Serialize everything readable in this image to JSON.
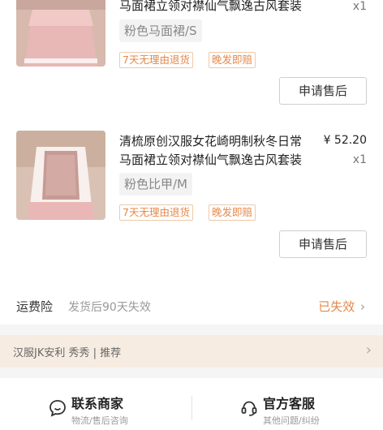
{
  "items": [
    {
      "title_line1": "",
      "title_line2": "马面裙立领对襟仙气飘逸古风套装",
      "price": "",
      "qty": "x1",
      "spec": "粉色马面裙/S",
      "tags": [
        "7天无理由退货",
        "晚发即赔"
      ],
      "button": "申请售后"
    },
    {
      "title_line1": "清梳原创汉服女花崎明制秋冬日常",
      "title_line2": "马面裙立领对襟仙气飘逸古风套装",
      "price": "¥ 52.20",
      "qty": "x1",
      "spec": "粉色比甲/M",
      "tags": [
        "7天无理由退货",
        "晚发即赔"
      ],
      "button": "申请售后"
    }
  ],
  "insurance": {
    "label": "运费险",
    "desc": "发货后90天失效",
    "status": "已失效",
    "arrow": "›"
  },
  "promo": {
    "text": "汉服JK安利  秀秀 | 推荐",
    "arrow": "›"
  },
  "footer": {
    "merchant": {
      "label": "联系商家",
      "sub": "物流/售后咨询",
      "icon": "chat-bubble-icon"
    },
    "service": {
      "label": "官方客服",
      "sub": "其他问题/纠纷",
      "icon": "headset-icon"
    }
  },
  "colors": {
    "accent": "#e4884a",
    "tag_border": "#efc9a8",
    "promo_bg": "#f7ece2"
  }
}
